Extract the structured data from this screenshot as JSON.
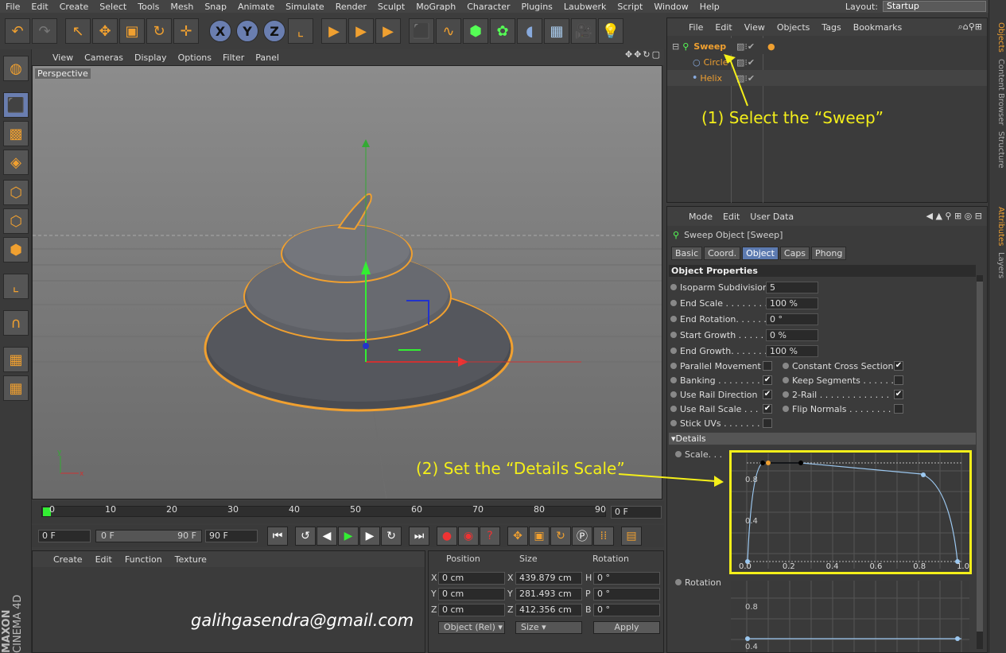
{
  "menubar": [
    "File",
    "Edit",
    "Create",
    "Select",
    "Tools",
    "Mesh",
    "Snap",
    "Animate",
    "Simulate",
    "Render",
    "Sculpt",
    "MoGraph",
    "Character",
    "Plugins",
    "Laubwerk",
    "Script",
    "Window",
    "Help"
  ],
  "layout": {
    "label": "Layout:",
    "value": "Startup"
  },
  "viewport": {
    "menu": [
      "View",
      "Cameras",
      "Display",
      "Options",
      "Filter",
      "Panel"
    ],
    "label": "Perspective"
  },
  "objects": {
    "menu": [
      "File",
      "Edit",
      "View",
      "Objects",
      "Tags",
      "Bookmarks"
    ],
    "items": [
      {
        "name": "Sweep",
        "color": "#f0a030"
      },
      {
        "name": "Circle",
        "color": "#f0a030"
      },
      {
        "name": "Helix",
        "color": "#f0a030"
      }
    ]
  },
  "sidebar_tabs": {
    "top": [
      "Objects",
      "Content Browser",
      "Structure"
    ],
    "bottom": [
      "Attributes",
      "Layers"
    ]
  },
  "attributes": {
    "menu": [
      "Mode",
      "Edit",
      "User Data"
    ],
    "title": "Sweep Object [Sweep]",
    "tabs": [
      "Basic",
      "Coord.",
      "Object",
      "Caps",
      "Phong"
    ],
    "active_tab": "Object",
    "section": "Object Properties",
    "fields": [
      {
        "label": "Isoparm Subdivision",
        "value": "5"
      },
      {
        "label": "End Scale . . . . . . . . .",
        "value": "100 %"
      },
      {
        "label": "End Rotation. . . . . .",
        "value": "0 °"
      },
      {
        "label": "Start Growth . . . . . .",
        "value": "0 %"
      },
      {
        "label": "End Growth. . . . . . .",
        "value": "100 %"
      }
    ],
    "checks_left": [
      {
        "label": "Parallel Movement",
        "checked": false
      },
      {
        "label": "Banking . . . . . . . .",
        "checked": true
      },
      {
        "label": "Use Rail Direction",
        "checked": true
      },
      {
        "label": "Use Rail Scale . . .",
        "checked": true
      },
      {
        "label": "Stick UVs . . . . . . .",
        "checked": false
      }
    ],
    "checks_right": [
      {
        "label": "Constant Cross Section",
        "checked": true
      },
      {
        "label": "Keep Segments . . . . . . .",
        "checked": false
      },
      {
        "label": "2-Rail . . . . . . . . . . . . .",
        "checked": true
      },
      {
        "label": "Flip Normals . . . . . . . . .",
        "checked": false
      }
    ],
    "details": "Details",
    "scale_label": "Scale. . .",
    "rotation_label": "Rotation",
    "graph_y_ticks": [
      "0.8",
      "0.4"
    ],
    "graph_x_ticks": [
      "0.0",
      "0.2",
      "0.4",
      "0.6",
      "0.8",
      "1.0"
    ],
    "rot_y_ticks": [
      "0.8",
      "0.4"
    ]
  },
  "timeline": {
    "ticks": [
      "0",
      "10",
      "20",
      "30",
      "40",
      "50",
      "60",
      "70",
      "80",
      "90"
    ],
    "frame": "0 F",
    "start": "0 F",
    "range_start": "0 F",
    "range_end": "90 F",
    "end": "90 F"
  },
  "material_menu": [
    "Create",
    "Edit",
    "Function",
    "Texture"
  ],
  "coords": {
    "headers": [
      "Position",
      "Size",
      "Rotation"
    ],
    "rows": [
      {
        "axis": "X",
        "pos": "0 cm",
        "size": "439.879 cm",
        "rot_axis": "H",
        "rot": "0 °"
      },
      {
        "axis": "Y",
        "pos": "0 cm",
        "size": "281.493 cm",
        "rot_axis": "P",
        "rot": "0 °"
      },
      {
        "axis": "Z",
        "pos": "0 cm",
        "size": "412.356 cm",
        "rot_axis": "B",
        "rot": "0 °"
      }
    ],
    "mode": "Object (Rel)",
    "size_mode": "Size",
    "apply": "Apply"
  },
  "annotations": {
    "step1": "(1) Select the “Sweep”",
    "step2": "(2) Set the “Details Scale”",
    "color": "#f4ef1a"
  },
  "email": "galihgasendra@gmail.com",
  "brand": {
    "top": "MAXON",
    "bottom": "CINEMA 4D"
  }
}
